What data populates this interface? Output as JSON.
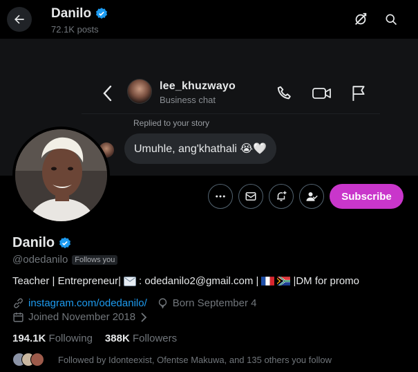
{
  "header": {
    "name": "Danilo",
    "posts": "72.1K posts"
  },
  "banner": {
    "chat_username": "lee_khuzwayo",
    "chat_subtitle": "Business chat",
    "replied_label": "Replied to your story",
    "message": "Umuhle, ang'khathali 😭🤍"
  },
  "actions": {
    "subscribe_label": "Subscribe"
  },
  "profile": {
    "name": "Danilo",
    "handle": "@odedanilo",
    "follows_you": "Follows you",
    "bio_prefix": "Teacher | Entrepreneur|",
    "bio_email": ": odedanilo2@gmail.com |",
    "bio_suffix": "|DM for promo",
    "link": "instagram.com/odedanilo/",
    "born": "Born September 4",
    "joined": "Joined November 2018",
    "following_count": "194.1K",
    "following_label": "Following",
    "followers_count": "388K",
    "followers_label": "Followers",
    "followed_by": "Followed by Idonteexist, Ofentse Makuwa, and 135 others you follow"
  },
  "colors": {
    "accent": "#1d9bf0",
    "subscribe": "#c936cb",
    "verified": "#1d9bf0"
  },
  "icons": [
    "back-arrow-icon",
    "verified-icon",
    "no-repost-icon",
    "search-icon",
    "chevron-left-icon",
    "phone-icon",
    "video-icon",
    "flag-icon",
    "more-icon",
    "mail-icon",
    "notification-add-icon",
    "follow-icon",
    "link-icon",
    "location-icon",
    "calendar-icon",
    "chevron-right-icon"
  ]
}
